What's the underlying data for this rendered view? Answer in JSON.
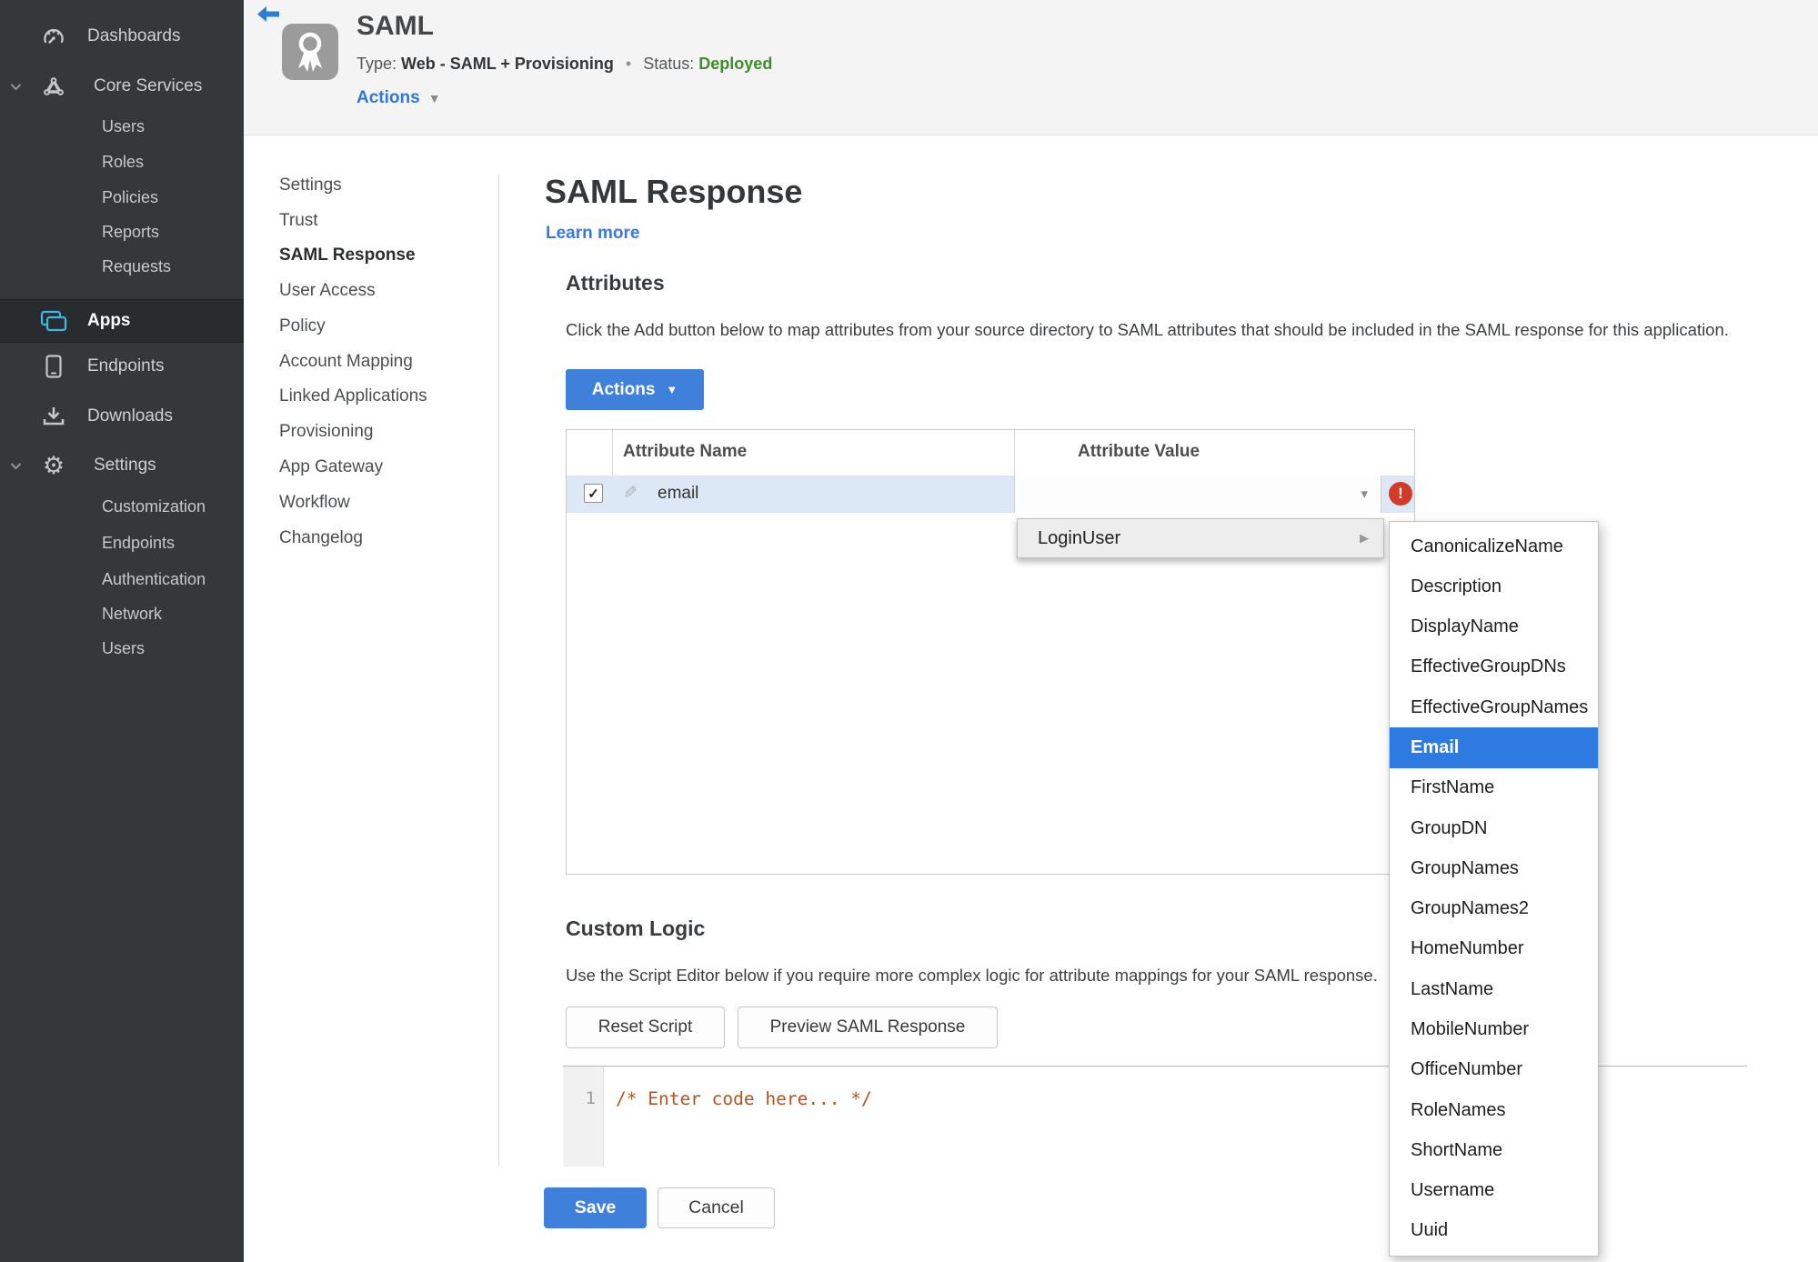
{
  "sidebar": {
    "items": [
      {
        "label": "Dashboards",
        "icon": "gauge-icon"
      },
      {
        "label": "Core Services",
        "icon": "core-services-icon",
        "expanded": true
      },
      {
        "label": "Users"
      },
      {
        "label": "Roles"
      },
      {
        "label": "Policies"
      },
      {
        "label": "Reports"
      },
      {
        "label": "Requests"
      },
      {
        "label": "Apps",
        "icon": "apps-icon",
        "active": true
      },
      {
        "label": "Endpoints",
        "icon": "phone-icon"
      },
      {
        "label": "Downloads",
        "icon": "download-icon"
      },
      {
        "label": "Settings",
        "icon": "gear-icon",
        "expanded": true
      },
      {
        "label": "Customization"
      },
      {
        "label": "Endpoints"
      },
      {
        "label": "Authentication"
      },
      {
        "label": "Network"
      },
      {
        "label": "Users"
      }
    ]
  },
  "header": {
    "title": "SAML",
    "type_label": "Type:",
    "type_value": "Web - SAML + Provisioning",
    "separator": "•",
    "status_label": "Status:",
    "status_value": "Deployed",
    "actions_label": "Actions"
  },
  "nav": {
    "items": [
      "Settings",
      "Trust",
      "SAML Response",
      "User Access",
      "Policy",
      "Account Mapping",
      "Linked Applications",
      "Provisioning",
      "App Gateway",
      "Workflow",
      "Changelog"
    ],
    "active": "SAML Response"
  },
  "main": {
    "title": "SAML Response",
    "learn_more": "Learn more",
    "attributes": {
      "heading": "Attributes",
      "description": "Click the Add button below to map attributes from your source directory to SAML attributes that should be included in the SAML response for this application.",
      "actions_button": "Actions",
      "table": {
        "columns": [
          "Attribute Name",
          "Attribute Value"
        ],
        "rows": [
          {
            "checked": true,
            "name": "email",
            "value": "",
            "error": true
          }
        ]
      }
    },
    "value_menu": {
      "parent": "LoginUser",
      "options": [
        "CanonicalizeName",
        "Description",
        "DisplayName",
        "EffectiveGroupDNs",
        "EffectiveGroupNames",
        "Email",
        "FirstName",
        "GroupDN",
        "GroupNames",
        "GroupNames2",
        "HomeNumber",
        "LastName",
        "MobileNumber",
        "OfficeNumber",
        "RoleNames",
        "ShortName",
        "Username",
        "Uuid"
      ],
      "highlighted": "Email"
    },
    "custom_logic": {
      "heading": "Custom Logic",
      "description": "Use the Script Editor below if you require more complex logic for attribute mappings for your SAML response.",
      "reset_button": "Reset Script",
      "preview_button": "Preview SAML Response",
      "editor": {
        "line_number": "1",
        "code": "/* Enter code here... */"
      }
    },
    "footer": {
      "save_button": "Save",
      "cancel_button": "Cancel"
    }
  },
  "colors": {
    "sidebar_bg": "#34383b",
    "accent_blue": "#3a7bd8",
    "button_blue": "#3e80da",
    "status_green": "#3e8e28",
    "error_red": "#d13b28",
    "selection_blue": "#2d7be0",
    "row_highlight": "#dce8f6",
    "code_comment": "#b0551f"
  }
}
